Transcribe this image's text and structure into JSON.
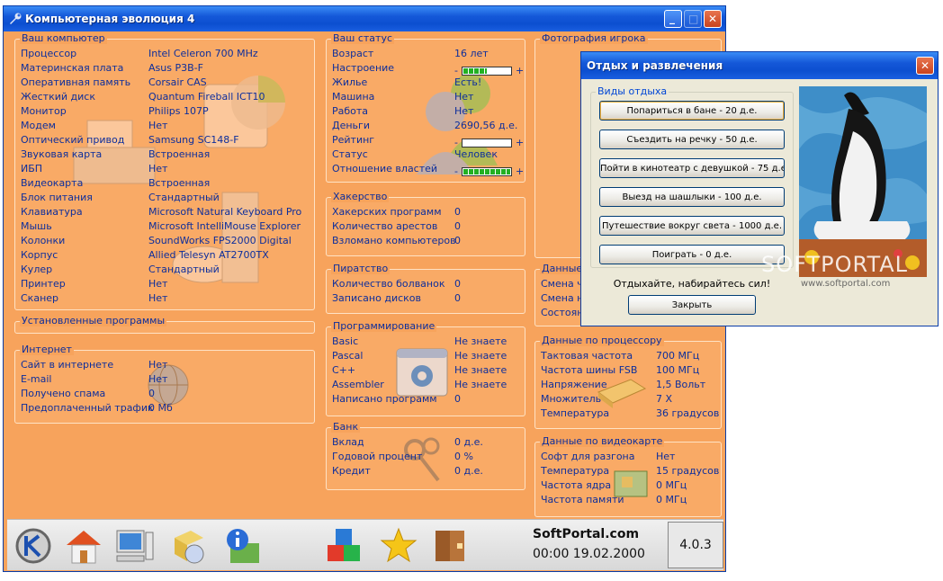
{
  "main_window": {
    "title": "Компьютерная эволюция 4",
    "controls": {
      "minimize": "_",
      "maximize": "□",
      "close": "✕"
    }
  },
  "computer": {
    "title": "Ваш компьютер",
    "rows": [
      {
        "label": "Процессор",
        "value": "Intel Celeron 700 MHz"
      },
      {
        "label": "Материнская плата",
        "value": "Asus P3B-F"
      },
      {
        "label": "Оперативная память",
        "value": "Corsair CAS"
      },
      {
        "label": "Жесткий диск",
        "value": "Quantum Fireball ICT10"
      },
      {
        "label": "Монитор",
        "value": "Philips 107P"
      },
      {
        "label": "Модем",
        "value": "Нет"
      },
      {
        "label": "Оптический привод",
        "value": "Samsung SC148-F"
      },
      {
        "label": "Звуковая карта",
        "value": "Встроенная"
      },
      {
        "label": "ИБП",
        "value": "Нет"
      },
      {
        "label": "Видеокарта",
        "value": "Встроенная"
      },
      {
        "label": "Блок питания",
        "value": "Стандартный"
      },
      {
        "label": "Клавиатура",
        "value": "Microsoft Natural Keyboard Pro"
      },
      {
        "label": "Мышь",
        "value": "Microsoft IntelliMouse Explorer"
      },
      {
        "label": "Колонки",
        "value": "SoundWorks FPS2000 Digital"
      },
      {
        "label": "Корпус",
        "value": "Allied Telesyn AT2700TX"
      },
      {
        "label": "Кулер",
        "value": "Стандартный"
      },
      {
        "label": "Принтер",
        "value": "Нет"
      },
      {
        "label": "Сканер",
        "value": "Нет"
      }
    ]
  },
  "installed": {
    "title": "Установленные программы"
  },
  "internet": {
    "title": "Интернет",
    "rows": [
      {
        "label": "Сайт в интернете",
        "value": "Нет"
      },
      {
        "label": "E-mail",
        "value": "Нет"
      },
      {
        "label": "Получено спама",
        "value": "0"
      },
      {
        "label": "Предоплаченный трафик",
        "value": "0 Мб"
      }
    ]
  },
  "status": {
    "title": "Ваш статус",
    "age_label": "Возраст",
    "age_value": "16 лет",
    "mood_label": "Настроение",
    "mood_level": 0.5,
    "housing_label": "Жилье",
    "housing_value": "Есть!",
    "car_label": "Машина",
    "car_value": "Нет",
    "job_label": "Работа",
    "job_value": "Нет",
    "money_label": "Деньги",
    "money_value": "2690,56 д.е.",
    "rating_label": "Рейтинг",
    "rating_level": 0,
    "status_label": "Статус",
    "status_value": "Человек",
    "authorities_label": "Отношение властей",
    "authorities_level": 1,
    "minus": "-",
    "plus": "+"
  },
  "hacking": {
    "title": "Хакерство",
    "rows": [
      {
        "label": "Хакерских программ",
        "value": "0"
      },
      {
        "label": "Количество арестов",
        "value": "0"
      },
      {
        "label": "Взломано компьютеров",
        "value": "0"
      }
    ]
  },
  "piracy": {
    "title": "Пиратство",
    "rows": [
      {
        "label": "Количество болванок",
        "value": "0"
      },
      {
        "label": "Записано дисков",
        "value": "0"
      }
    ]
  },
  "programming": {
    "title": "Программирование",
    "rows": [
      {
        "label": "Basic",
        "value": "Не знаете"
      },
      {
        "label": "Pascal",
        "value": "Не знаете"
      },
      {
        "label": "C++",
        "value": "Не знаете"
      },
      {
        "label": "Assembler",
        "value": "Не знаете"
      },
      {
        "label": "Написано программ",
        "value": "0"
      }
    ]
  },
  "bank": {
    "title": "Банк",
    "rows": [
      {
        "label": "Вклад",
        "value": "0 д.е."
      },
      {
        "label": "Годовой процент",
        "value": "0 %"
      },
      {
        "label": "Кредит",
        "value": "0 д.е."
      }
    ]
  },
  "photo_group": {
    "title": "Фотография игрока"
  },
  "partial_group": {
    "title": "Данные п",
    "rows": [
      {
        "label": "Смена ча"
      },
      {
        "label": "Смена на"
      },
      {
        "label": "Состояни"
      }
    ]
  },
  "cpu": {
    "title": "Данные по процессору",
    "rows": [
      {
        "label": "Тактовая частота",
        "value": "700 МГц"
      },
      {
        "label": "Частота шины FSB",
        "value": "100 МГц"
      },
      {
        "label": "Напряжение",
        "value": "1,5 Вольт"
      },
      {
        "label": "Множитель",
        "value": "7 X"
      },
      {
        "label": "Температура",
        "value": "36 градусов"
      }
    ]
  },
  "video": {
    "title": "Данные по видеокарте",
    "rows": [
      {
        "label": "Софт для разгона",
        "value": "Нет"
      },
      {
        "label": "Температура",
        "value": "15 градусов"
      },
      {
        "label": "Частота ядра",
        "value": "0 МГц"
      },
      {
        "label": "Частота памяти",
        "value": "0 МГц"
      }
    ]
  },
  "toolbar": {
    "site": "SoftPortal.com",
    "datetime": "00:00 19.02.2000",
    "version": "4.0.3"
  },
  "dialog": {
    "title": "Отдых и развлечения",
    "group_title": "Виды отдыха",
    "buttons": [
      "Попариться в бане - 20 д.е.",
      "Съездить на речку - 50 д.е.",
      "Пойти в кинотеатр с девушкой - 75 д.е.",
      "Выезд на шашлыки - 100 д.е.",
      "Путешествие вокруг света - 1000 д.е.",
      "Поиграть - 0 д.е."
    ],
    "message": "Отдыхайте, набирайтесь сил!",
    "close_label": "Закрыть",
    "watermark": "SOFTPORTAL",
    "watermark_url": "www.softportal.com"
  }
}
